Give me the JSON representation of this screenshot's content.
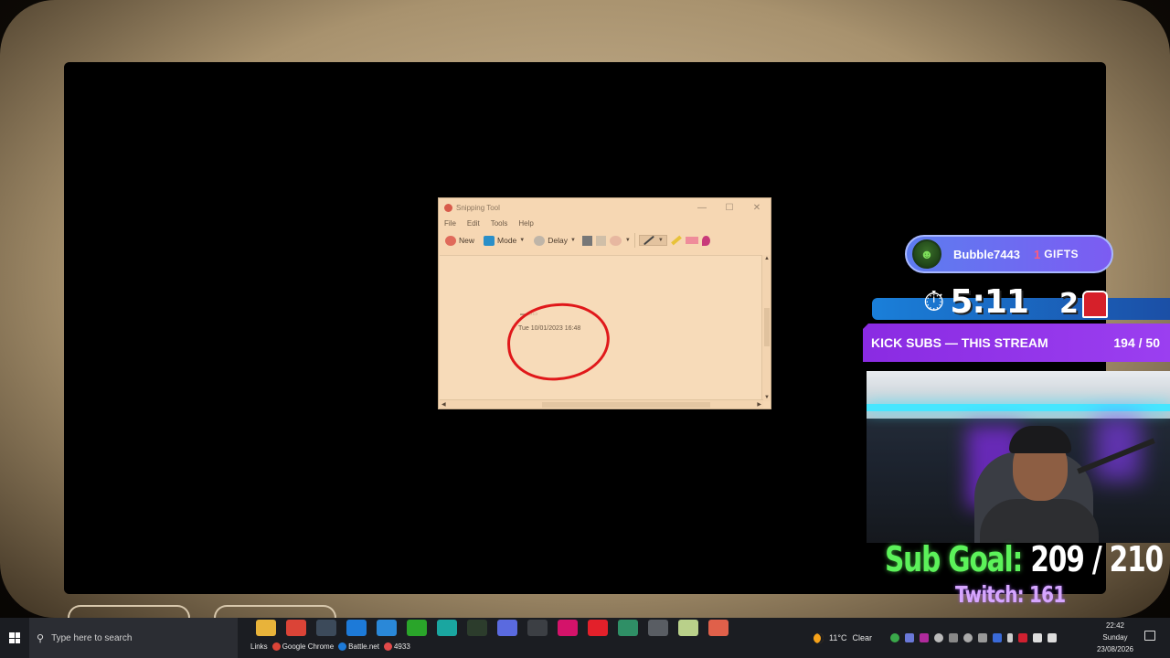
{
  "snipping_tool": {
    "title": "Snipping Tool",
    "menu": [
      "File",
      "Edit",
      "Tools",
      "Help"
    ],
    "toolbar": {
      "new_label": "New",
      "mode_label": "Mode",
      "delay_label": "Delay"
    },
    "window_controls": {
      "minimize": "—",
      "maximize": "☐",
      "close": "✕"
    },
    "canvas": {
      "date_text": "Tue 10/01/2023 16:48"
    }
  },
  "stream": {
    "gift": {
      "username": "Bubble7443",
      "count": "1",
      "label": "GIFTS"
    },
    "timer": {
      "value": "5:11",
      "counter": "2"
    },
    "kick": {
      "label": "KICK SUBS — THIS STREAM",
      "value": "194 / 50"
    },
    "sub_goal": {
      "label": "Sub Goal:",
      "value": "209 / 210"
    },
    "twitch": "Twitch: 161"
  },
  "taskbar": {
    "search_placeholder": "Type here to search",
    "apps": [
      {
        "name": "file-explorer",
        "color": "#e8b33a"
      },
      {
        "name": "chrome",
        "color": "#db4437"
      },
      {
        "name": "steam-like",
        "color": "#3c4a5a"
      },
      {
        "name": "battle-net",
        "color": "#1d7ad8"
      },
      {
        "name": "mail",
        "color": "#2a88d8"
      },
      {
        "name": "xbox",
        "color": "#2aa52a"
      },
      {
        "name": "edge",
        "color": "#1aa6a0"
      },
      {
        "name": "app-green",
        "color": "#2c3c2c"
      },
      {
        "name": "obs",
        "color": "#5a6adf"
      },
      {
        "name": "terminal",
        "color": "#3c3f44"
      },
      {
        "name": "next",
        "color": "#d4136a"
      },
      {
        "name": "app-red",
        "color": "#e3202a"
      },
      {
        "name": "app-teal",
        "color": "#2f8f66"
      },
      {
        "name": "app-gray",
        "color": "#595d63"
      },
      {
        "name": "notes",
        "color": "#b9d08a"
      },
      {
        "name": "snipping",
        "color": "#e0604a"
      }
    ],
    "links": {
      "label": "Links",
      "chrome": "Google Chrome",
      "battlenet": "Battle.net",
      "count": "4933"
    },
    "weather": {
      "temp": "11°C",
      "condition": "Clear"
    },
    "clock": {
      "time": "22:42",
      "day": "Sunday",
      "date": "23/08/2026"
    }
  }
}
